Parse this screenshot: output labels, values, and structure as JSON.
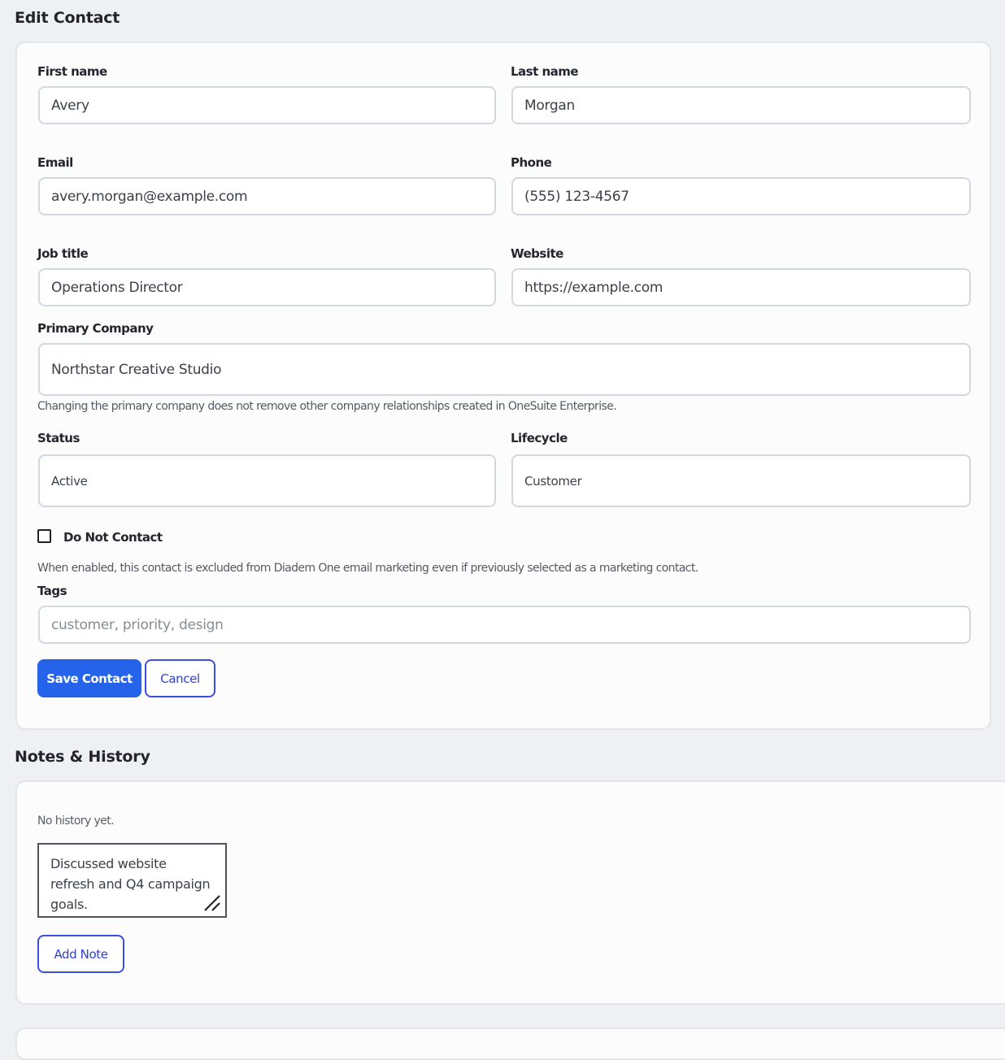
{
  "edit_contact": {
    "title": "Edit Contact",
    "first_name": {
      "label": "First name",
      "value": "Avery"
    },
    "last_name": {
      "label": "Last name",
      "value": "Morgan"
    },
    "email": {
      "label": "Email",
      "value": "avery.morgan@example.com"
    },
    "phone": {
      "label": "Phone",
      "value": "(555) 123-4567"
    },
    "job_title": {
      "label": "Job title",
      "value": "Operations Director"
    },
    "website": {
      "label": "Website",
      "value": "https://example.com"
    },
    "primary_company": {
      "label": "Primary Company",
      "value": "Northstar Creative Studio",
      "help": "Changing the primary company does not remove other company relationships created in OneSuite Enterprise."
    },
    "status": {
      "label": "Status",
      "value": "Active"
    },
    "lifecycle": {
      "label": "Lifecycle",
      "value": "Customer"
    },
    "do_not_contact": {
      "label": "Do Not Contact",
      "checked": false,
      "help": "When enabled, this contact is excluded from Diadem One email marketing even if previously selected as a marketing contact."
    },
    "tags": {
      "label": "Tags",
      "placeholder": "customer, priority, design"
    },
    "save_label": "Save Contact",
    "cancel_label": "Cancel"
  },
  "notes_history": {
    "title": "Notes & History",
    "empty_text": "No history yet.",
    "note_value": "Discussed website refresh and Q4 campaign goals.",
    "add_note_label": "Add Note"
  },
  "colors": {
    "primary": "#2563eb",
    "outline": "#3b4ee0",
    "background": "#eef0f3"
  }
}
